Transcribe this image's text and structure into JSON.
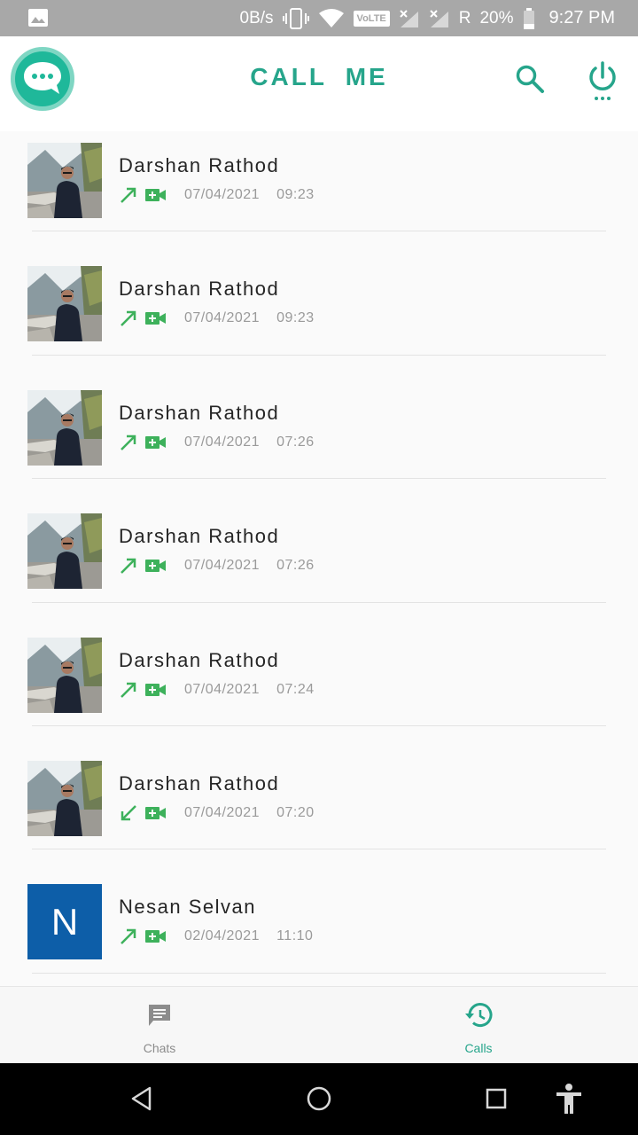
{
  "status_bar": {
    "net_speed": "0B/s",
    "volte": "VoLTE",
    "roaming": "R",
    "battery": "20%",
    "time": "9:27 PM"
  },
  "app_bar": {
    "title_word1": "CALL",
    "title_word2": "ME",
    "icons": [
      "chat-bubble-logo",
      "search-icon",
      "power-icon"
    ]
  },
  "colors": {
    "accent": "#26a58b",
    "call_green": "#3db15b",
    "avatar_blue": "#0d5ea8",
    "status_bar": "#a8a8a8"
  },
  "calls": [
    {
      "name": "Darshan Rathod",
      "direction": "outgoing",
      "type": "video",
      "date": "07/04/2021",
      "time": "09:23",
      "avatar": "photo"
    },
    {
      "name": "Darshan Rathod",
      "direction": "outgoing",
      "type": "video",
      "date": "07/04/2021",
      "time": "09:23",
      "avatar": "photo"
    },
    {
      "name": "Darshan Rathod",
      "direction": "outgoing",
      "type": "video",
      "date": "07/04/2021",
      "time": "07:26",
      "avatar": "photo"
    },
    {
      "name": "Darshan Rathod",
      "direction": "outgoing",
      "type": "video",
      "date": "07/04/2021",
      "time": "07:26",
      "avatar": "photo"
    },
    {
      "name": "Darshan Rathod",
      "direction": "outgoing",
      "type": "video",
      "date": "07/04/2021",
      "time": "07:24",
      "avatar": "photo"
    },
    {
      "name": "Darshan Rathod",
      "direction": "incoming",
      "type": "video",
      "date": "07/04/2021",
      "time": "07:20",
      "avatar": "photo"
    },
    {
      "name": "Nesan Selvan",
      "direction": "outgoing",
      "type": "video",
      "date": "02/04/2021",
      "time": "11:10",
      "avatar": "letter",
      "avatar_letter": "N"
    }
  ],
  "bottom_nav": {
    "tabs": [
      {
        "label": "Chats",
        "icon": "chat-icon",
        "active": false
      },
      {
        "label": "Calls",
        "icon": "history-icon",
        "active": true
      }
    ]
  },
  "system_nav": [
    "back-icon",
    "home-icon",
    "recents-icon",
    "accessibility-icon"
  ]
}
